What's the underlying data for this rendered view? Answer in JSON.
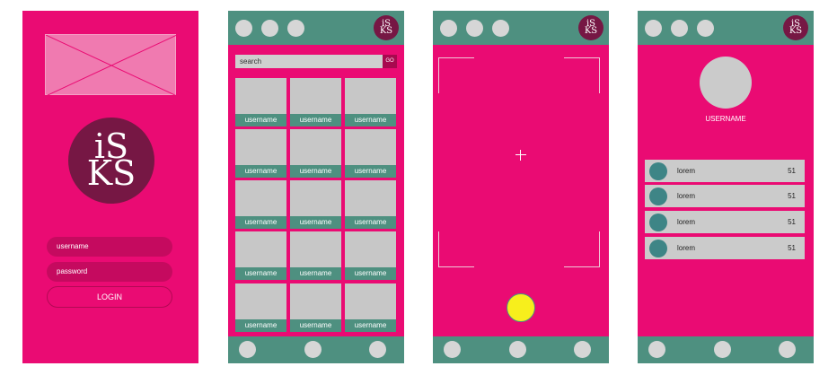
{
  "logo": {
    "line1": "iS",
    "line2": "KS"
  },
  "login_screen": {
    "username_placeholder": "username",
    "password_placeholder": "password",
    "login_label": "LOGIN"
  },
  "search_screen": {
    "search_placeholder": "search",
    "go_label": "GO",
    "tiles": [
      "username",
      "username",
      "username",
      "username",
      "username",
      "username",
      "username",
      "username",
      "username",
      "username",
      "username",
      "username",
      "username",
      "username",
      "username"
    ]
  },
  "profile_screen": {
    "username": "USERNAME",
    "rows": [
      {
        "text": "lorem",
        "value": "51"
      },
      {
        "text": "lorem",
        "value": "51"
      },
      {
        "text": "lorem",
        "value": "51"
      },
      {
        "text": "lorem",
        "value": "51"
      }
    ]
  },
  "colors": {
    "primary_pink": "#ea0b73",
    "teal_bar": "#4e9080",
    "logo_maroon": "#761744",
    "shutter_yellow": "#f7ef1c"
  }
}
